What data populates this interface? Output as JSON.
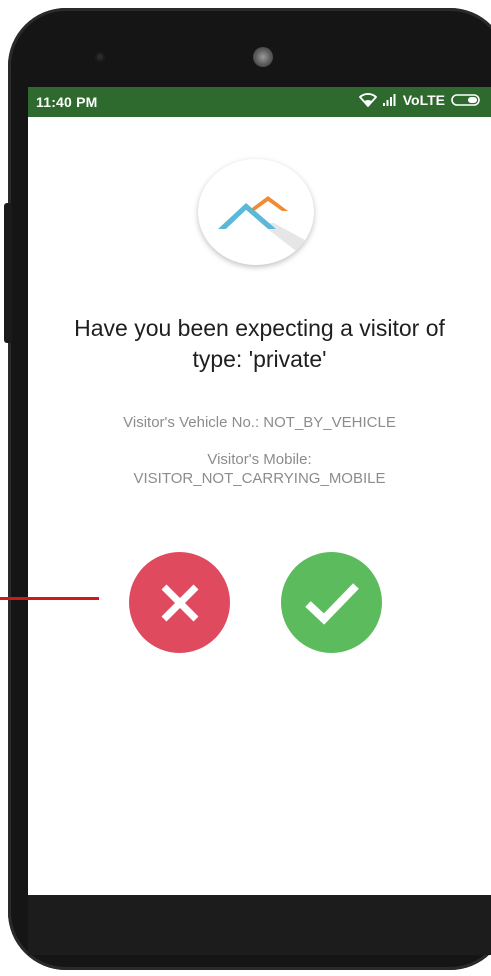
{
  "status_bar": {
    "time": "11:40 PM",
    "network": "VoLTE",
    "icons": [
      "wifi-icon",
      "signal-icon",
      "battery-icon"
    ],
    "color": "#2e6a2e"
  },
  "logo": {
    "icon": "roof-logo-icon"
  },
  "prompt": {
    "question": "Have you been expecting a visitor of type: 'private'",
    "vehicle": "Visitor's Vehicle No.: NOT_BY_VEHICLE",
    "mobile_label": "Visitor's Mobile:",
    "mobile_value": "VISITOR_NOT_CARRYING_MOBILE"
  },
  "actions": {
    "reject": {
      "icon": "close-icon",
      "color": "#e04a5f"
    },
    "accept": {
      "icon": "check-icon",
      "color": "#5cbb5c"
    }
  }
}
